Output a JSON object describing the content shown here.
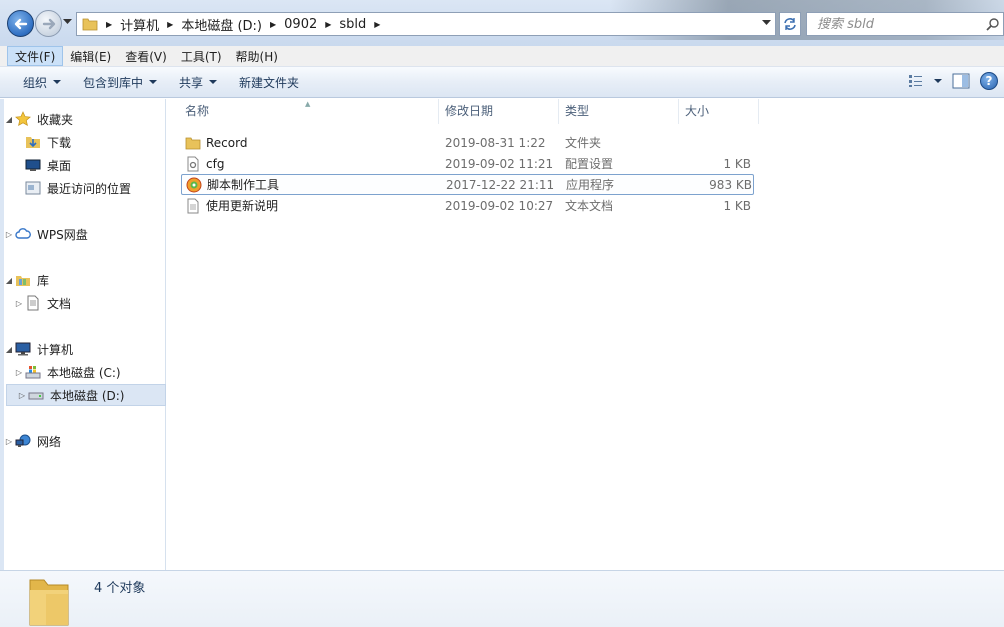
{
  "address": {
    "crumbs": [
      "计算机",
      "本地磁盘 (D:)",
      "0902",
      "sbld"
    ],
    "search_placeholder": "搜索 sbld"
  },
  "menu": [
    "文件(F)",
    "编辑(E)",
    "查看(V)",
    "工具(T)",
    "帮助(H)"
  ],
  "commands": {
    "organize": "组织",
    "include_library": "包含到库中",
    "share": "共享",
    "new_folder": "新建文件夹"
  },
  "nav": {
    "favorites": "收藏夹",
    "downloads": "下载",
    "desktop": "桌面",
    "recent": "最近访问的位置",
    "wps": "WPS网盘",
    "libraries": "库",
    "documents": "文档",
    "computer": "计算机",
    "drive_c": "本地磁盘 (C:)",
    "drive_d": "本地磁盘 (D:)",
    "network": "网络"
  },
  "columns": {
    "name": "名称",
    "modified": "修改日期",
    "type": "类型",
    "size": "大小"
  },
  "files": [
    {
      "name": "Record",
      "modified": "2019-08-31 1:22",
      "type": "文件夹",
      "size": "",
      "icon": "folder-icon"
    },
    {
      "name": "cfg",
      "modified": "2019-09-02 11:21",
      "type": "配置设置",
      "size": "1 KB",
      "icon": "config-file-icon"
    },
    {
      "name": "脚本制作工具",
      "modified": "2017-12-22 21:11",
      "type": "应用程序",
      "size": "983 KB",
      "icon": "app-icon"
    },
    {
      "name": "使用更新说明",
      "modified": "2019-09-02 10:27",
      "type": "文本文档",
      "size": "1 KB",
      "icon": "text-file-icon"
    }
  ],
  "status": {
    "count": "4 个对象"
  }
}
